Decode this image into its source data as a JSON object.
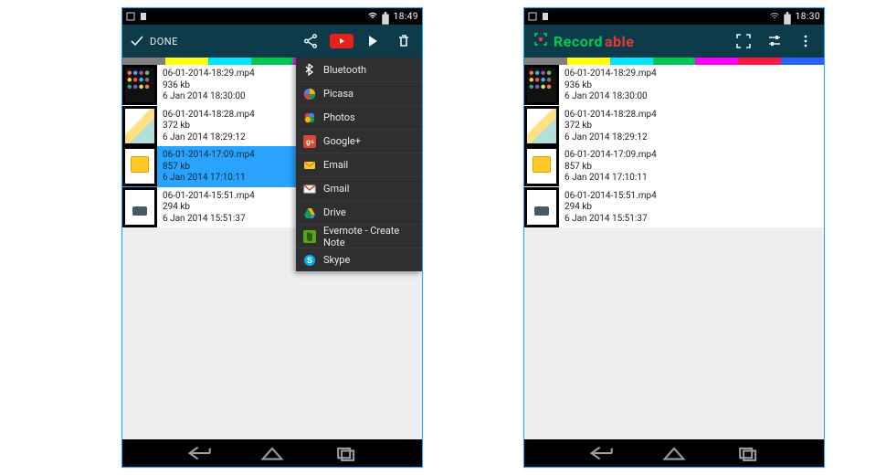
{
  "status": {
    "time_left": "18:49",
    "time_right": "18:30"
  },
  "left": {
    "done_label": "DONE",
    "colorbar": [
      "#808080",
      "#ffff00",
      "#00e5ff",
      "#00c853",
      "#ff00ff",
      "#ff1744",
      "#2962ff"
    ],
    "recordings": [
      {
        "file": "06-01-2014-18:29.mp4",
        "size": "936 kb",
        "ts": "6 Jan 2014 18:30:00",
        "thumb": "apps",
        "selected": false
      },
      {
        "file": "06-01-2014-18:28.mp4",
        "size": "372 kb",
        "ts": "6 Jan 2014 18:29:12",
        "thumb": "pics",
        "selected": false
      },
      {
        "file": "06-01-2014-17:09.mp4",
        "size": "857 kb",
        "ts": "6 Jan 2014 17:10:11",
        "thumb": "gift",
        "selected": true
      },
      {
        "file": "06-01-2014-15:51.mp4",
        "size": "294 kb",
        "ts": "6 Jan 2014 15:51:37",
        "thumb": "blank",
        "selected": false
      }
    ],
    "share_menu": [
      {
        "label": "Bluetooth",
        "icon": "bluetooth",
        "bg": "#2196f3"
      },
      {
        "label": "Picasa",
        "icon": "picasa",
        "bg": "#ffffff"
      },
      {
        "label": "Photos",
        "icon": "photos",
        "bg": "#ffffff"
      },
      {
        "label": "Google+",
        "icon": "gplus",
        "bg": "#db4437"
      },
      {
        "label": "Email",
        "icon": "email",
        "bg": "#fbc02d"
      },
      {
        "label": "Gmail",
        "icon": "gmail",
        "bg": "#ffffff"
      },
      {
        "label": "Drive",
        "icon": "drive",
        "bg": "#ffffff"
      },
      {
        "label": "Evernote - Create Note",
        "icon": "evernote",
        "bg": "#58a618"
      },
      {
        "label": "Skype",
        "icon": "skype",
        "bg": "#00aff0"
      }
    ]
  },
  "right": {
    "brand_part1": "Record",
    "brand_part2": "able",
    "colorbar": [
      "#808080",
      "#ffff00",
      "#00e5ff",
      "#00c853",
      "#ff00ff",
      "#ff1744",
      "#2962ff"
    ],
    "recordings": [
      {
        "file": "06-01-2014-18:29.mp4",
        "size": "936 kb",
        "ts": "6 Jan 2014 18:30:00",
        "thumb": "apps"
      },
      {
        "file": "06-01-2014-18:28.mp4",
        "size": "372 kb",
        "ts": "6 Jan 2014 18:29:12",
        "thumb": "pics"
      },
      {
        "file": "06-01-2014-17:09.mp4",
        "size": "857 kb",
        "ts": "6 Jan 2014 17:10:11",
        "thumb": "gift"
      },
      {
        "file": "06-01-2014-15:51.mp4",
        "size": "294 kb",
        "ts": "6 Jan 2014 15:51:37",
        "thumb": "blank"
      }
    ]
  }
}
